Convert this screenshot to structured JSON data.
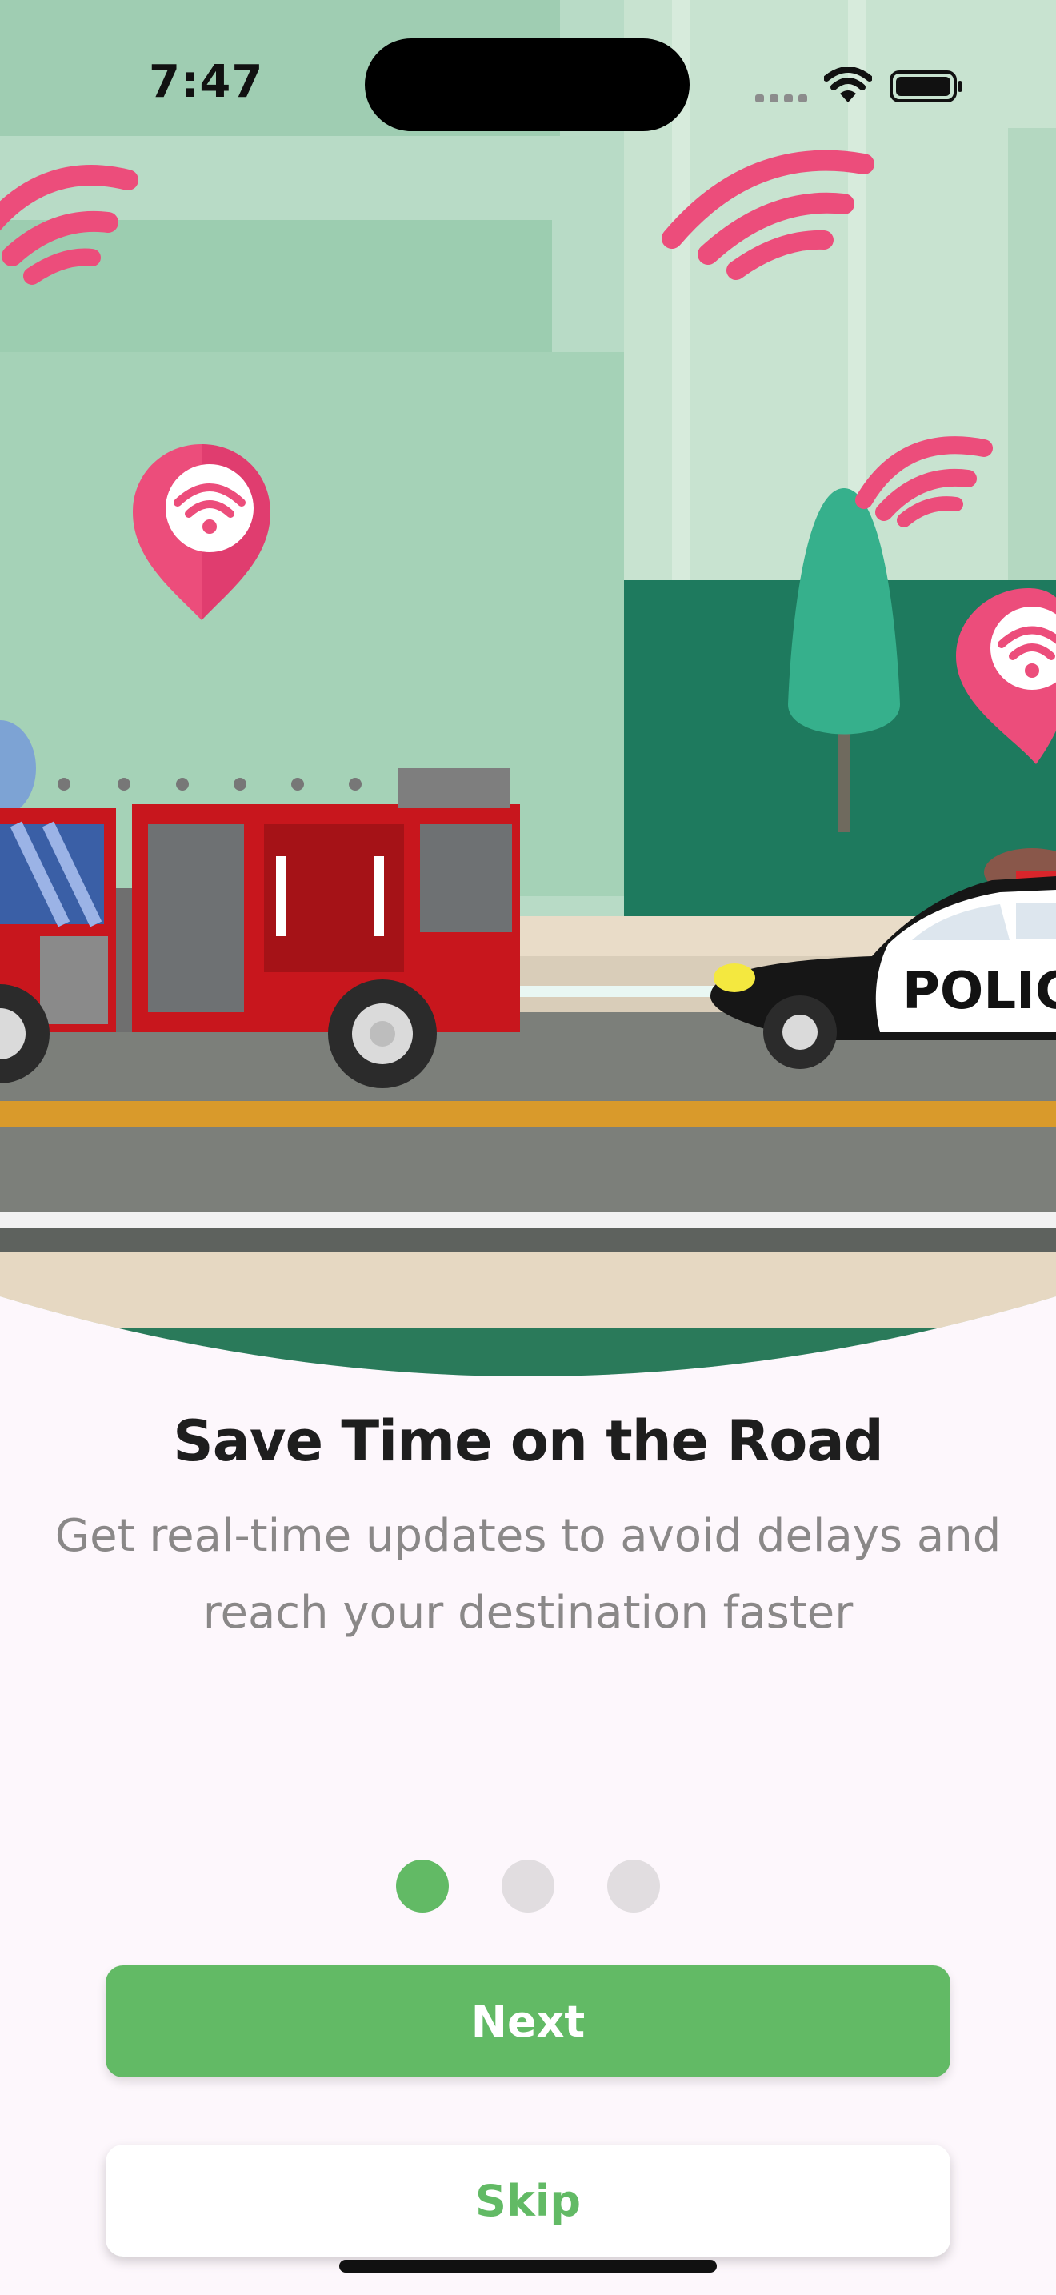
{
  "status_bar": {
    "time": "7:47"
  },
  "illustration": {
    "vehicle_label": "POLIC",
    "icons": [
      "wifi-signal-icon",
      "location-pin-icon"
    ]
  },
  "onboarding": {
    "title": "Save Time on the Road",
    "subtitle": "Get real-time updates to avoid delays and reach your destination faster",
    "page_indicator": {
      "total": 3,
      "active_index": 0
    }
  },
  "buttons": {
    "next_label": "Next",
    "skip_label": "Skip"
  },
  "colors": {
    "accent": "#62BA65",
    "background": "#FDF7FC",
    "title": "#1E1E1E",
    "subtitle": "#8A8888",
    "inactive_dot": "#E1DDE0",
    "illustration_pink": "#EC4D7B",
    "fire_truck_red": "#C8161D"
  }
}
